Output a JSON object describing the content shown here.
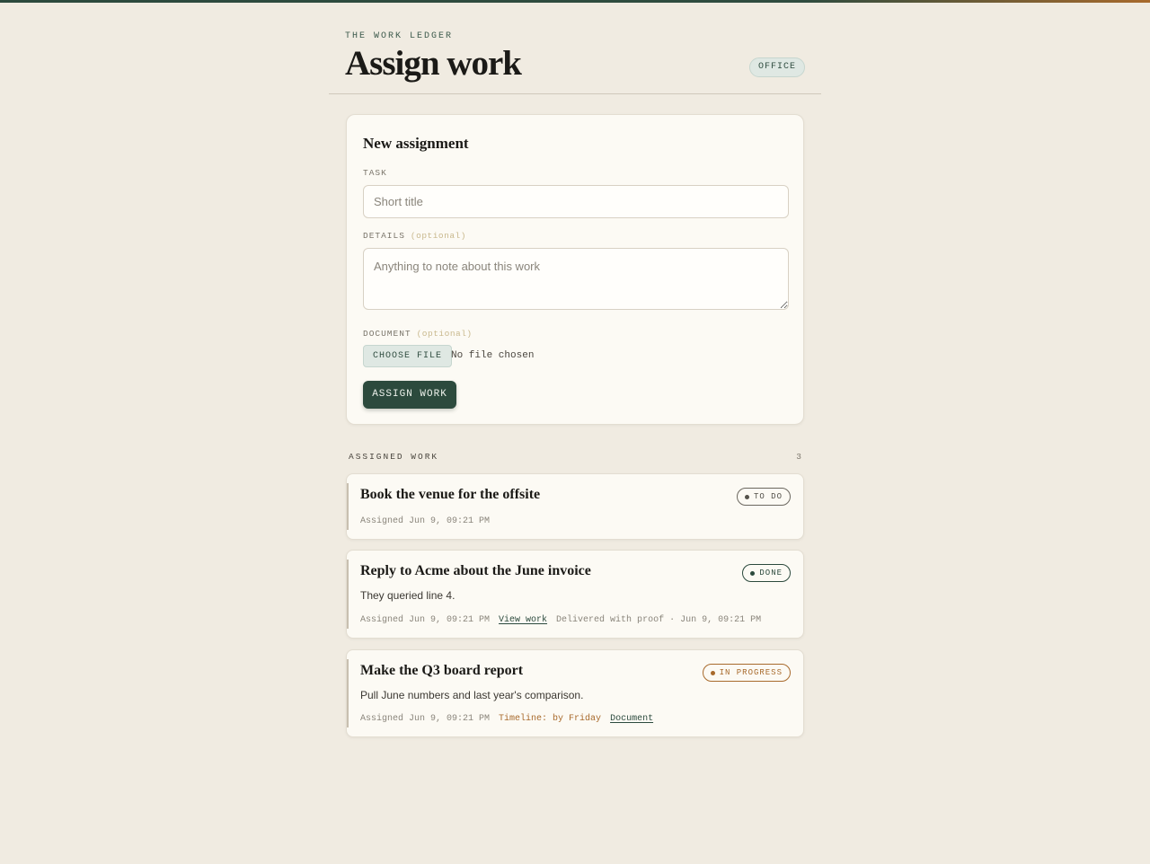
{
  "header": {
    "eyebrow": "THE WORK LEDGER",
    "title": "Assign work",
    "role_badge": "OFFICE"
  },
  "form": {
    "title": "New assignment",
    "task_label": "TASK",
    "task_placeholder": "Short title",
    "task_value": "",
    "details_label": "DETAILS",
    "details_optional": "(optional)",
    "details_placeholder": "Anything to note about this work",
    "details_value": "",
    "document_label": "DOCUMENT",
    "document_optional": "(optional)",
    "choose_file_label": "CHOOSE FILE",
    "file_status": "No file chosen",
    "submit_label": "ASSIGN WORK"
  },
  "assigned": {
    "heading": "ASSIGNED WORK",
    "count": "3",
    "items": [
      {
        "title": "Book the venue for the offsite",
        "status": "TO DO",
        "assigned": "Assigned Jun 9, 09:21 PM"
      },
      {
        "title": "Reply to Acme about the June invoice",
        "status": "DONE",
        "description": "They queried line 4.",
        "assigned": "Assigned Jun 9, 09:21 PM",
        "link": "View work",
        "delivered": "Delivered with proof · Jun 9, 09:21 PM"
      },
      {
        "title": "Make the Q3 board report",
        "status": "IN PROGRESS",
        "description": "Pull June numbers and last year's comparison.",
        "assigned": "Assigned Jun 9, 09:21 PM",
        "timeline": "Timeline: by Friday",
        "link": "Document"
      }
    ]
  },
  "colors": {
    "background": "#f0ebe1",
    "card": "#fcfaf4",
    "primary": "#2c4a3d",
    "accent_amber": "#a86a2c"
  }
}
